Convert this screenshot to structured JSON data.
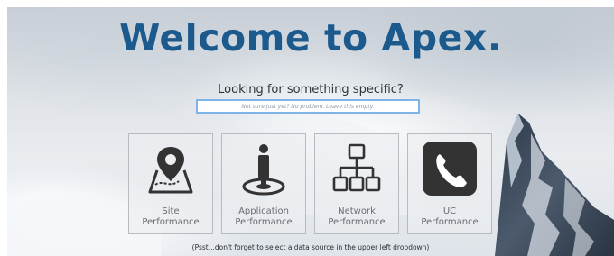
{
  "page": {
    "title": "Welcome to Apex.",
    "subtitle": "Looking for something specific?",
    "footer": "(Psst...don't forget to select a data source in the upper left dropdown)"
  },
  "search": {
    "value": "",
    "placeholder": "Not sure just yet? No problem. Leave this empty."
  },
  "tiles": [
    {
      "line1": "Site",
      "line2": "Performance",
      "icon": "map-pin-icon"
    },
    {
      "line1": "Application",
      "line2": "Performance",
      "icon": "person-on-target-icon"
    },
    {
      "line1": "Network",
      "line2": "Performance",
      "icon": "network-hierarchy-icon"
    },
    {
      "line1": "UC",
      "line2": "Performance",
      "icon": "phone-icon"
    }
  ],
  "colors": {
    "title": "#1c5a8e",
    "search_border": "#7fb4e6",
    "icon": "#333333",
    "tile_label": "#6a6d70"
  }
}
